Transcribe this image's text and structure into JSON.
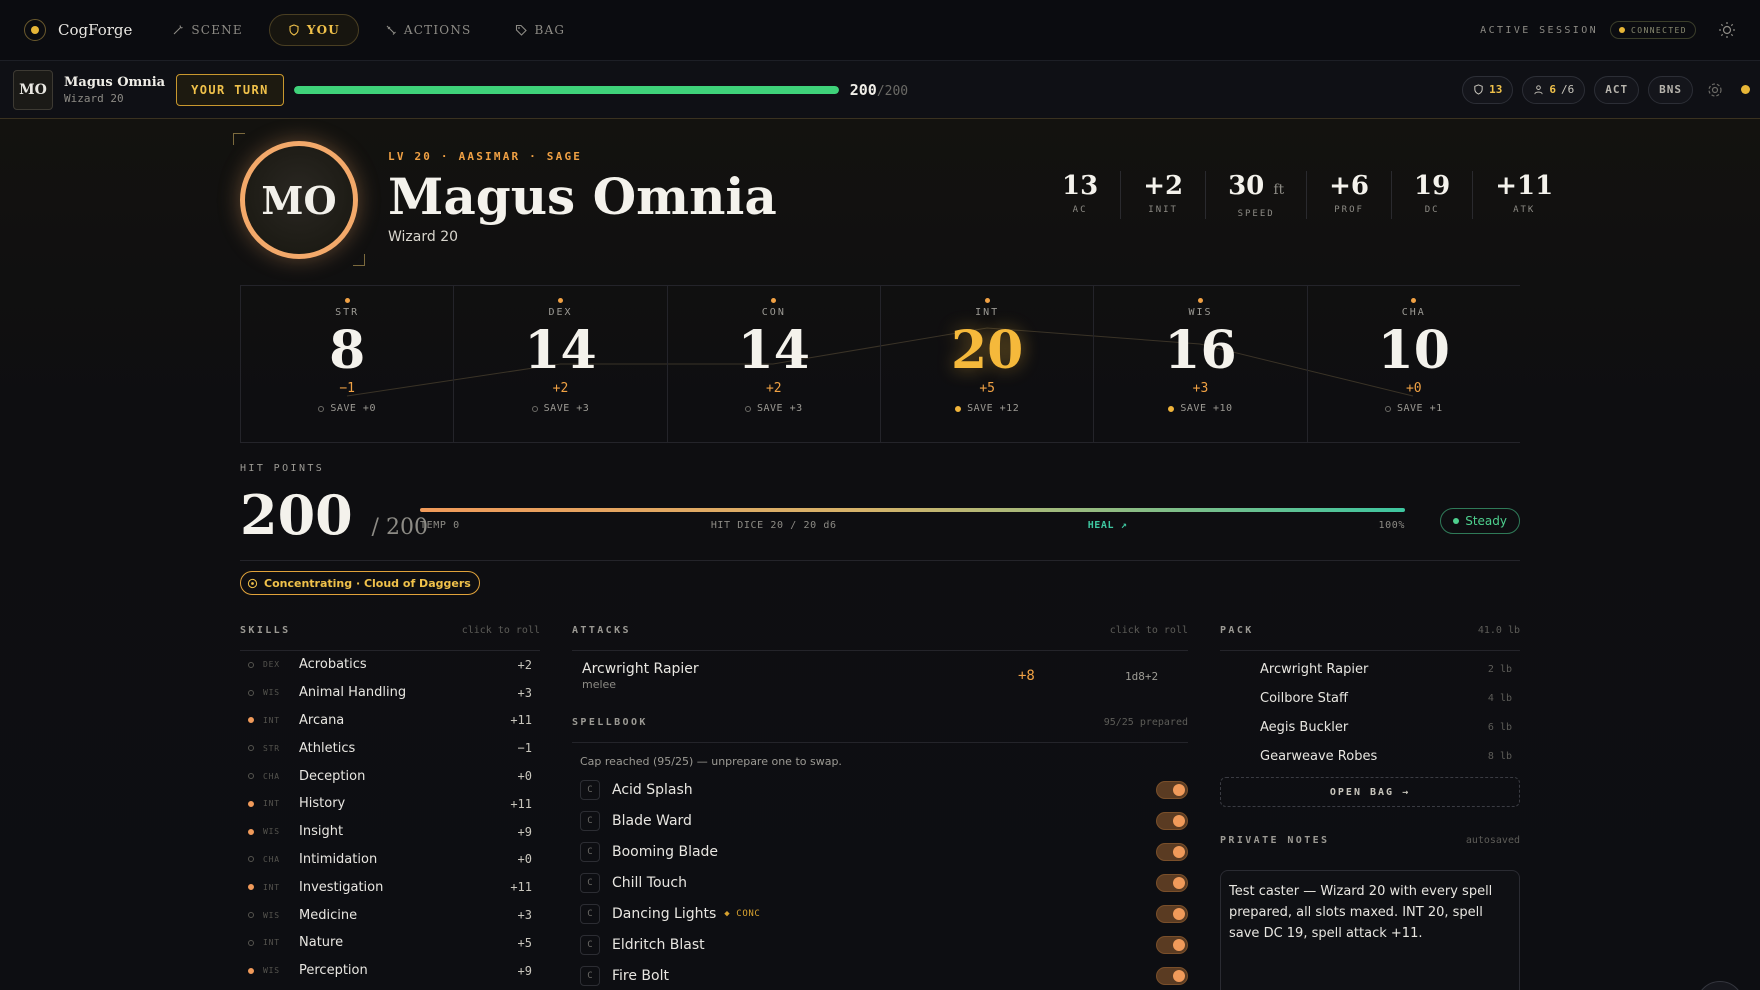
{
  "brand": {
    "name": "CogForge"
  },
  "nav": {
    "tabs": [
      {
        "label": "SCENE",
        "icon": "wand-icon",
        "active": false
      },
      {
        "label": "YOU",
        "icon": "shield-icon",
        "active": true
      },
      {
        "label": "ACTIONS",
        "icon": "sword-icon",
        "active": false
      },
      {
        "label": "BAG",
        "icon": "tag-icon",
        "active": false
      }
    ],
    "session_label": "ACTIVE SESSION",
    "connection": "CONNECTED"
  },
  "turnbar": {
    "avatar_initials": "MO",
    "name": "Magus Omnia",
    "class": "Wizard 20",
    "turn_label": "YOUR TURN",
    "hp_current": "200",
    "hp_max": "/200",
    "hp_fraction": 1.0,
    "ac_chip": "13",
    "slots_used": "6",
    "slots_total": "/6",
    "act_label": "ACT",
    "bns_label": "BNS"
  },
  "hero": {
    "initials": "MO",
    "tagline": "LV 20 · AASIMAR · SAGE",
    "name": "Magus Omnia",
    "class_line": "Wizard 20"
  },
  "combat_stats": [
    {
      "value": "13",
      "unit": "",
      "label": "AC"
    },
    {
      "value": "+2",
      "unit": "",
      "label": "INIT"
    },
    {
      "value": "30",
      "unit": "ft",
      "label": "SPEED"
    },
    {
      "value": "+6",
      "unit": "",
      "label": "PROF"
    },
    {
      "value": "19",
      "unit": "",
      "label": "DC"
    },
    {
      "value": "+11",
      "unit": "",
      "label": "ATK"
    }
  ],
  "abilities": [
    {
      "name": "STR",
      "score": "8",
      "mod": "−1",
      "save": "SAVE +0",
      "proficient": false,
      "highlight": false
    },
    {
      "name": "DEX",
      "score": "14",
      "mod": "+2",
      "save": "SAVE +3",
      "proficient": false,
      "highlight": false
    },
    {
      "name": "CON",
      "score": "14",
      "mod": "+2",
      "save": "SAVE +3",
      "proficient": false,
      "highlight": false
    },
    {
      "name": "INT",
      "score": "20",
      "mod": "+5",
      "save": "SAVE +12",
      "proficient": true,
      "highlight": true
    },
    {
      "name": "WIS",
      "score": "16",
      "mod": "+3",
      "save": "SAVE +10",
      "proficient": true,
      "highlight": false
    },
    {
      "name": "CHA",
      "score": "10",
      "mod": "+0",
      "save": "SAVE +1",
      "proficient": false,
      "highlight": false
    }
  ],
  "hit_points": {
    "label": "HIT POINTS",
    "current": "200",
    "max": "/ 200",
    "temp": "TEMP 0",
    "hit_dice": "HIT DICE 20 / 20 d6",
    "heal": "HEAL ↗",
    "percent": "100%",
    "status": "Steady"
  },
  "concentration": "Concentrating · Cloud of Daggers",
  "skills": {
    "title": "SKILLS",
    "hint": "click to roll",
    "items": [
      {
        "ability": "DEX",
        "name": "Acrobatics",
        "bonus": "+2",
        "proficient": false
      },
      {
        "ability": "WIS",
        "name": "Animal Handling",
        "bonus": "+3",
        "proficient": false
      },
      {
        "ability": "INT",
        "name": "Arcana",
        "bonus": "+11",
        "proficient": true
      },
      {
        "ability": "STR",
        "name": "Athletics",
        "bonus": "−1",
        "proficient": false
      },
      {
        "ability": "CHA",
        "name": "Deception",
        "bonus": "+0",
        "proficient": false
      },
      {
        "ability": "INT",
        "name": "History",
        "bonus": "+11",
        "proficient": true
      },
      {
        "ability": "WIS",
        "name": "Insight",
        "bonus": "+9",
        "proficient": true
      },
      {
        "ability": "CHA",
        "name": "Intimidation",
        "bonus": "+0",
        "proficient": false
      },
      {
        "ability": "INT",
        "name": "Investigation",
        "bonus": "+11",
        "proficient": true
      },
      {
        "ability": "WIS",
        "name": "Medicine",
        "bonus": "+3",
        "proficient": false
      },
      {
        "ability": "INT",
        "name": "Nature",
        "bonus": "+5",
        "proficient": false
      },
      {
        "ability": "WIS",
        "name": "Perception",
        "bonus": "+9",
        "proficient": true
      }
    ]
  },
  "attacks": {
    "title": "ATTACKS",
    "hint": "click to roll",
    "items": [
      {
        "name": "Arcwright Rapier",
        "type": "melee",
        "hit": "+8",
        "damage": "1d8+2"
      }
    ]
  },
  "spellbook": {
    "title": "SPELLBOOK",
    "hint": "95/25 prepared",
    "cap_note": "Cap reached (95/25) — unprepare one to swap.",
    "spells": [
      {
        "level": "C",
        "name": "Acid Splash",
        "conc": ""
      },
      {
        "level": "C",
        "name": "Blade Ward",
        "conc": ""
      },
      {
        "level": "C",
        "name": "Booming Blade",
        "conc": ""
      },
      {
        "level": "C",
        "name": "Chill Touch",
        "conc": ""
      },
      {
        "level": "C",
        "name": "Dancing Lights",
        "conc": "◆ CONC"
      },
      {
        "level": "C",
        "name": "Eldritch Blast",
        "conc": ""
      },
      {
        "level": "C",
        "name": "Fire Bolt",
        "conc": ""
      }
    ]
  },
  "pack": {
    "title": "PACK",
    "weight": "41.0 lb",
    "items": [
      {
        "name": "Arcwright Rapier",
        "weight": "2 lb"
      },
      {
        "name": "Coilbore Staff",
        "weight": "4 lb"
      },
      {
        "name": "Aegis Buckler",
        "weight": "6 lb"
      },
      {
        "name": "Gearweave Robes",
        "weight": "8 lb"
      }
    ],
    "open_bag": "OPEN BAG →"
  },
  "notes": {
    "title": "PRIVATE NOTES",
    "status": "autosaved",
    "text": "Test caster — Wizard 20 with every spell prepared, all slots maxed. INT 20, spell save DC 19, spell attack +11."
  },
  "colors": {
    "accent": "#f0c14a",
    "orange": "#f0a144",
    "hp_green": "#3fd27a"
  }
}
